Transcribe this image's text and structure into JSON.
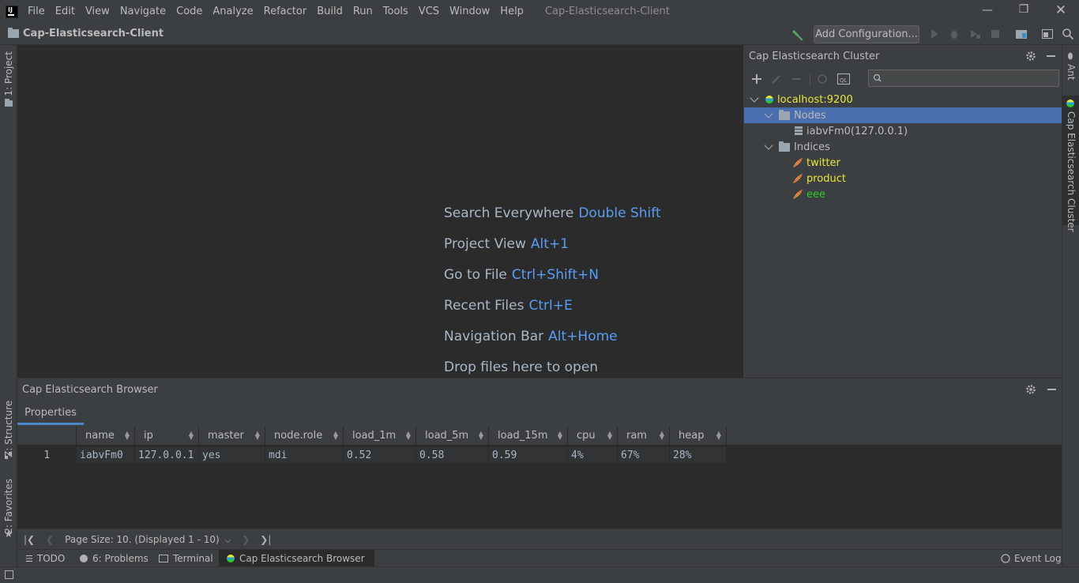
{
  "menubar": {
    "items": [
      "File",
      "Edit",
      "View",
      "Navigate",
      "Code",
      "Analyze",
      "Refactor",
      "Build",
      "Run",
      "Tools",
      "VCS",
      "Window",
      "Help"
    ],
    "window_title": "Cap-Elasticsearch-Client"
  },
  "navbar": {
    "project": "Cap-Elasticsearch-Client",
    "add_configuration": "Add Configuration..."
  },
  "left_strip": {
    "project_tab": "1: Project",
    "structure_tab": "Z: Structure",
    "favorites_tab": "2: Favorites"
  },
  "right_strip": {
    "ant_tab": "Ant",
    "cluster_tab": "Cap Elasticsearch Cluster"
  },
  "editor": {
    "hints": [
      {
        "text": "Search Everywhere",
        "key": "Double Shift"
      },
      {
        "text": "Project View",
        "key": "Alt+1"
      },
      {
        "text": "Go to File",
        "key": "Ctrl+Shift+N"
      },
      {
        "text": "Recent Files",
        "key": "Ctrl+E"
      },
      {
        "text": "Navigation Bar",
        "key": "Alt+Home"
      },
      {
        "text": "Drop files here to open",
        "key": ""
      }
    ]
  },
  "cluster_panel": {
    "title": "Cap Elasticsearch Cluster",
    "tree": {
      "host": "localhost:9200",
      "nodes_label": "Nodes",
      "node": "iabvFm0(127.0.0.1)",
      "indices_label": "Indices",
      "indices": [
        {
          "name": "twitter",
          "color": "#e8e83a"
        },
        {
          "name": "product",
          "color": "#e8e83a"
        },
        {
          "name": "eee",
          "color": "#29cc29"
        }
      ]
    },
    "colors": {
      "host": "#e8e83a",
      "selection": "#4b6eaf"
    }
  },
  "browser_panel": {
    "title": "Cap Elasticsearch Browser",
    "tab": "Properties",
    "columns": [
      "name",
      "ip",
      "master",
      "node.role",
      "load_1m",
      "load_5m",
      "load_15m",
      "cpu",
      "ram",
      "heap"
    ],
    "rows": [
      {
        "num": "1",
        "cells": [
          "iabvFm0",
          "127.0.0.1",
          "yes",
          "mdi",
          "0.52",
          "0.58",
          "0.59",
          "4%",
          "67%",
          "28%"
        ]
      }
    ],
    "pager": {
      "page_size": "Page Size: 10. (Displayed 1 - 10)"
    }
  },
  "tool_tabs": {
    "todo": "TODO",
    "problems": "6: Problems",
    "terminal": "Terminal",
    "browser": "Cap Elasticsearch Browser",
    "event_log": "Event Log"
  }
}
